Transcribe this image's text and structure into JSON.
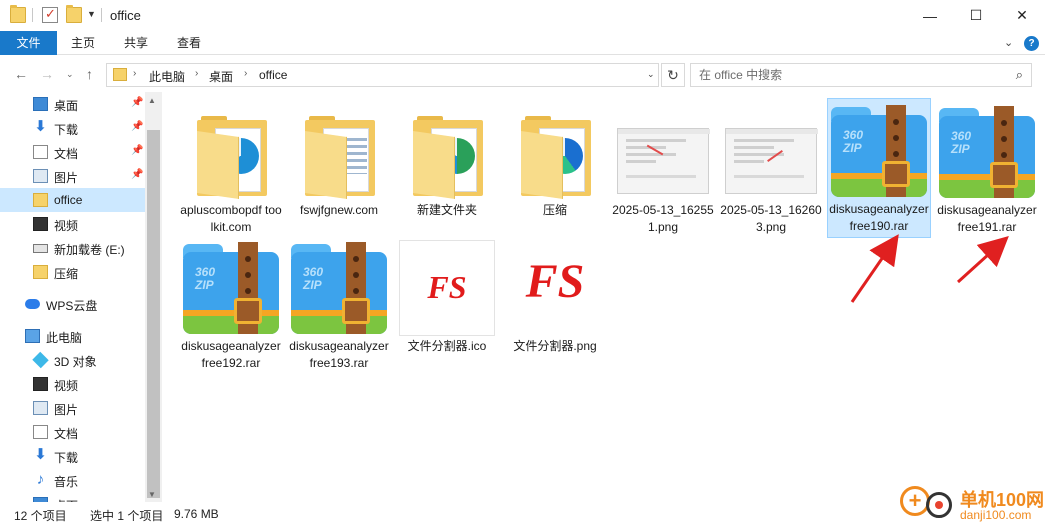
{
  "window": {
    "title": "office",
    "min_icon": "minimize-icon",
    "max_icon": "maximize-icon",
    "close_icon": "close-icon"
  },
  "ribbon": {
    "tabs": [
      "文件",
      "主页",
      "共享",
      "查看"
    ],
    "accent": "#1979ca"
  },
  "address": {
    "crumbs": [
      "此电脑",
      "桌面",
      "office"
    ]
  },
  "search": {
    "placeholder": "在 office 中搜索"
  },
  "nav": {
    "items": [
      {
        "label": "桌面",
        "icon": "desktop-icon",
        "pinned": true
      },
      {
        "label": "下载",
        "icon": "download-icon",
        "pinned": true
      },
      {
        "label": "文档",
        "icon": "document-icon",
        "pinned": true
      },
      {
        "label": "图片",
        "icon": "pictures-icon",
        "pinned": true
      },
      {
        "label": "office",
        "icon": "folder-icon",
        "selected": true
      },
      {
        "label": "视频",
        "icon": "video-icon"
      },
      {
        "label": "新加载卷 (E:)",
        "icon": "drive-icon"
      },
      {
        "label": "压缩",
        "icon": "folder-icon"
      },
      {
        "label": "WPS云盘",
        "icon": "cloud-icon"
      },
      {
        "label": "此电脑",
        "icon": "computer-icon"
      },
      {
        "label": "3D 对象",
        "icon": "3d-objects-icon"
      },
      {
        "label": "视频",
        "icon": "video-icon"
      },
      {
        "label": "图片",
        "icon": "pictures-icon"
      },
      {
        "label": "文档",
        "icon": "document-icon"
      },
      {
        "label": "下载",
        "icon": "download-icon"
      },
      {
        "label": "音乐",
        "icon": "music-icon"
      },
      {
        "label": "桌面",
        "icon": "desktop-icon"
      }
    ]
  },
  "files": [
    {
      "name": "apluscombopdf toolkit.com",
      "type": "folder",
      "mark": "#1e8fd6"
    },
    {
      "name": "fswjfgnew.com",
      "type": "folder",
      "mark": "#9fb6cf"
    },
    {
      "name": "新建文件夹",
      "type": "folder",
      "mark": "#2aa05a"
    },
    {
      "name": "压缩",
      "type": "folder",
      "mark": "#1a6fd0"
    },
    {
      "name": "2025-05-13_162551.png",
      "type": "png"
    },
    {
      "name": "2025-05-13_162603.png",
      "type": "png"
    },
    {
      "name": "diskusageanalyzerfree190.rar",
      "type": "rar",
      "selected": true
    },
    {
      "name": "diskusageanalyzerfree191.rar",
      "type": "rar"
    },
    {
      "name": "diskusageanalyzerfree192.rar",
      "type": "rar"
    },
    {
      "name": "diskusageanalyzerfree193.rar",
      "type": "rar"
    },
    {
      "name": "文件分割器.ico",
      "type": "ico"
    },
    {
      "name": "文件分割器.png",
      "type": "fspng"
    }
  ],
  "zip_label": [
    "360",
    "ZIP"
  ],
  "fs_text": "FS",
  "status": {
    "count": "12 个项目",
    "selection": "选中 1 个项目",
    "size": "9.76 MB"
  },
  "watermark": {
    "cn": "单机100网",
    "en": "danji100.com"
  },
  "colors": {
    "selection": "#cce8ff",
    "arrow": "#e02020"
  }
}
